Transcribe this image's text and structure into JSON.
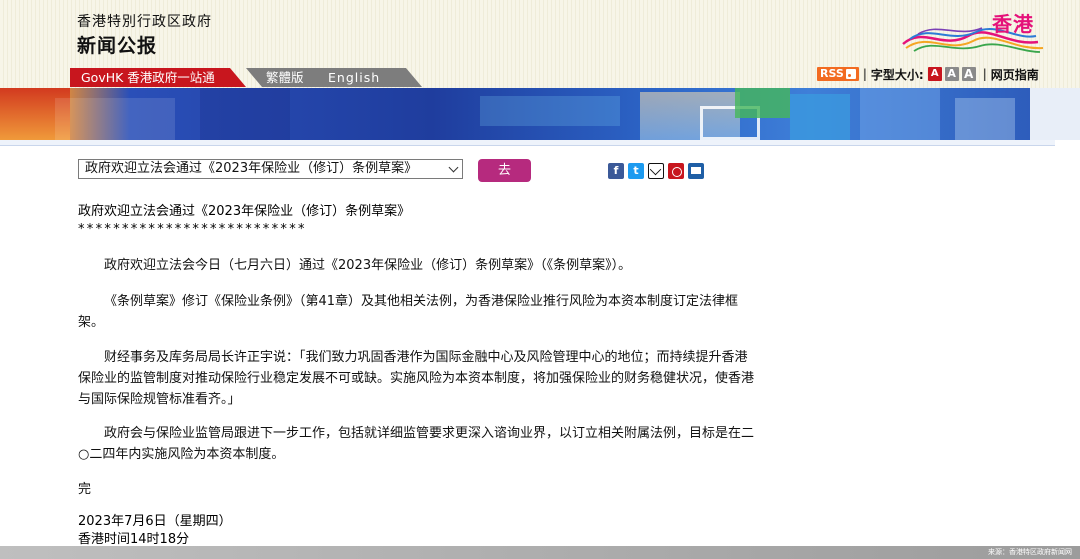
{
  "header": {
    "gov_name": "香港特別行政区政府",
    "gazette": "新闻公报",
    "logo_text": "香港"
  },
  "nav": {
    "govhk": "GovHK 香港政府一站通",
    "traditional": "繁體版",
    "english": "English"
  },
  "tools": {
    "rss": "RSS",
    "font_size_label": "字型大小:",
    "font_small": "A",
    "font_medium": "A",
    "font_large": "A",
    "guide": "网页指南",
    "separator": "|"
  },
  "selector": {
    "selected": "政府欢迎立法会通过《2023年保险业（修订）条例草案》",
    "go": "去"
  },
  "share": {
    "facebook": "f",
    "twitter": "t"
  },
  "article": {
    "title": "政府欢迎立法会通过《2023年保险业（修订）条例草案》",
    "stars": "**************************",
    "p1": "政府欢迎立法会今日（七月六日）通过《2023年保险业（修订）条例草案》（《条例草案》）。",
    "p2": "《条例草案》修订《保险业条例》（第41章）及其他相关法例，为香港保险业推行风险为本资本制度订定法律框架。",
    "p3": "财经事务及库务局局长许正宇说：「我们致力巩固香港作为国际金融中心及风险管理中心的地位；而持续提升香港保险业的监管制度对推动保险行业稳定发展不可或缺。实施风险为本资本制度，将加强保险业的财务稳健状况，使香港与国际保险规管标准看齐。」",
    "p4": "政府会与保险业监管局跟进下一步工作，包括就详细监管要求更深入谘询业界，以订立相关附属法例，目标是在二○二四年内实施风险为本资本制度。",
    "end": "完",
    "date": "2023年7月6日（星期四）",
    "time": "香港时间14时18分"
  },
  "footer": {
    "source": "来源：香港特区政府新闻网"
  },
  "colors": {
    "govhk_red": "#c8161e",
    "go_button": "#b62a7e",
    "rss_orange": "#f26b21",
    "logo_pink": "#e5127a"
  }
}
